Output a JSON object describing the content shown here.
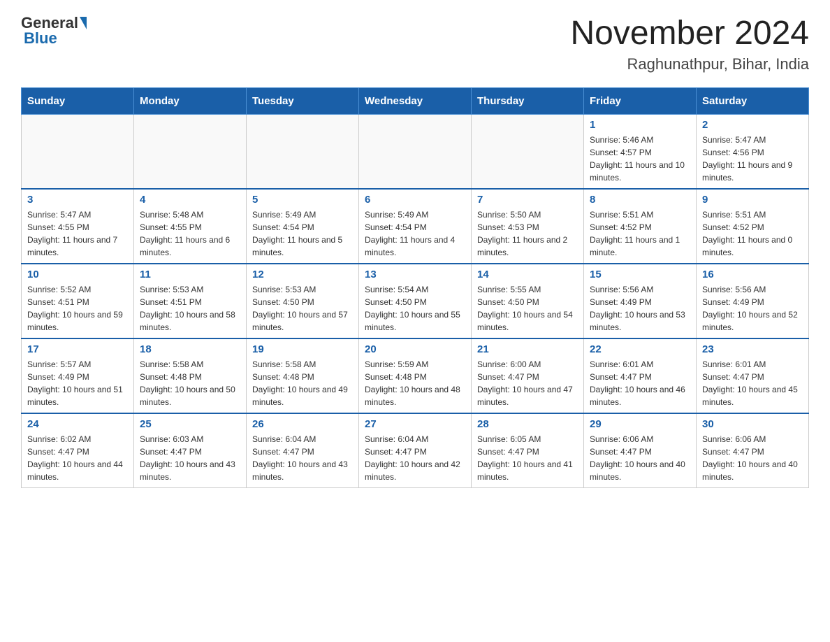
{
  "logo": {
    "text_general": "General",
    "text_blue": "Blue"
  },
  "header": {
    "title": "November 2024",
    "subtitle": "Raghunathpur, Bihar, India"
  },
  "weekdays": [
    "Sunday",
    "Monday",
    "Tuesday",
    "Wednesday",
    "Thursday",
    "Friday",
    "Saturday"
  ],
  "weeks": [
    [
      {
        "day": "",
        "sunrise": "",
        "sunset": "",
        "daylight": ""
      },
      {
        "day": "",
        "sunrise": "",
        "sunset": "",
        "daylight": ""
      },
      {
        "day": "",
        "sunrise": "",
        "sunset": "",
        "daylight": ""
      },
      {
        "day": "",
        "sunrise": "",
        "sunset": "",
        "daylight": ""
      },
      {
        "day": "",
        "sunrise": "",
        "sunset": "",
        "daylight": ""
      },
      {
        "day": "1",
        "sunrise": "Sunrise: 5:46 AM",
        "sunset": "Sunset: 4:57 PM",
        "daylight": "Daylight: 11 hours and 10 minutes."
      },
      {
        "day": "2",
        "sunrise": "Sunrise: 5:47 AM",
        "sunset": "Sunset: 4:56 PM",
        "daylight": "Daylight: 11 hours and 9 minutes."
      }
    ],
    [
      {
        "day": "3",
        "sunrise": "Sunrise: 5:47 AM",
        "sunset": "Sunset: 4:55 PM",
        "daylight": "Daylight: 11 hours and 7 minutes."
      },
      {
        "day": "4",
        "sunrise": "Sunrise: 5:48 AM",
        "sunset": "Sunset: 4:55 PM",
        "daylight": "Daylight: 11 hours and 6 minutes."
      },
      {
        "day": "5",
        "sunrise": "Sunrise: 5:49 AM",
        "sunset": "Sunset: 4:54 PM",
        "daylight": "Daylight: 11 hours and 5 minutes."
      },
      {
        "day": "6",
        "sunrise": "Sunrise: 5:49 AM",
        "sunset": "Sunset: 4:54 PM",
        "daylight": "Daylight: 11 hours and 4 minutes."
      },
      {
        "day": "7",
        "sunrise": "Sunrise: 5:50 AM",
        "sunset": "Sunset: 4:53 PM",
        "daylight": "Daylight: 11 hours and 2 minutes."
      },
      {
        "day": "8",
        "sunrise": "Sunrise: 5:51 AM",
        "sunset": "Sunset: 4:52 PM",
        "daylight": "Daylight: 11 hours and 1 minute."
      },
      {
        "day": "9",
        "sunrise": "Sunrise: 5:51 AM",
        "sunset": "Sunset: 4:52 PM",
        "daylight": "Daylight: 11 hours and 0 minutes."
      }
    ],
    [
      {
        "day": "10",
        "sunrise": "Sunrise: 5:52 AM",
        "sunset": "Sunset: 4:51 PM",
        "daylight": "Daylight: 10 hours and 59 minutes."
      },
      {
        "day": "11",
        "sunrise": "Sunrise: 5:53 AM",
        "sunset": "Sunset: 4:51 PM",
        "daylight": "Daylight: 10 hours and 58 minutes."
      },
      {
        "day": "12",
        "sunrise": "Sunrise: 5:53 AM",
        "sunset": "Sunset: 4:50 PM",
        "daylight": "Daylight: 10 hours and 57 minutes."
      },
      {
        "day": "13",
        "sunrise": "Sunrise: 5:54 AM",
        "sunset": "Sunset: 4:50 PM",
        "daylight": "Daylight: 10 hours and 55 minutes."
      },
      {
        "day": "14",
        "sunrise": "Sunrise: 5:55 AM",
        "sunset": "Sunset: 4:50 PM",
        "daylight": "Daylight: 10 hours and 54 minutes."
      },
      {
        "day": "15",
        "sunrise": "Sunrise: 5:56 AM",
        "sunset": "Sunset: 4:49 PM",
        "daylight": "Daylight: 10 hours and 53 minutes."
      },
      {
        "day": "16",
        "sunrise": "Sunrise: 5:56 AM",
        "sunset": "Sunset: 4:49 PM",
        "daylight": "Daylight: 10 hours and 52 minutes."
      }
    ],
    [
      {
        "day": "17",
        "sunrise": "Sunrise: 5:57 AM",
        "sunset": "Sunset: 4:49 PM",
        "daylight": "Daylight: 10 hours and 51 minutes."
      },
      {
        "day": "18",
        "sunrise": "Sunrise: 5:58 AM",
        "sunset": "Sunset: 4:48 PM",
        "daylight": "Daylight: 10 hours and 50 minutes."
      },
      {
        "day": "19",
        "sunrise": "Sunrise: 5:58 AM",
        "sunset": "Sunset: 4:48 PM",
        "daylight": "Daylight: 10 hours and 49 minutes."
      },
      {
        "day": "20",
        "sunrise": "Sunrise: 5:59 AM",
        "sunset": "Sunset: 4:48 PM",
        "daylight": "Daylight: 10 hours and 48 minutes."
      },
      {
        "day": "21",
        "sunrise": "Sunrise: 6:00 AM",
        "sunset": "Sunset: 4:47 PM",
        "daylight": "Daylight: 10 hours and 47 minutes."
      },
      {
        "day": "22",
        "sunrise": "Sunrise: 6:01 AM",
        "sunset": "Sunset: 4:47 PM",
        "daylight": "Daylight: 10 hours and 46 minutes."
      },
      {
        "day": "23",
        "sunrise": "Sunrise: 6:01 AM",
        "sunset": "Sunset: 4:47 PM",
        "daylight": "Daylight: 10 hours and 45 minutes."
      }
    ],
    [
      {
        "day": "24",
        "sunrise": "Sunrise: 6:02 AM",
        "sunset": "Sunset: 4:47 PM",
        "daylight": "Daylight: 10 hours and 44 minutes."
      },
      {
        "day": "25",
        "sunrise": "Sunrise: 6:03 AM",
        "sunset": "Sunset: 4:47 PM",
        "daylight": "Daylight: 10 hours and 43 minutes."
      },
      {
        "day": "26",
        "sunrise": "Sunrise: 6:04 AM",
        "sunset": "Sunset: 4:47 PM",
        "daylight": "Daylight: 10 hours and 43 minutes."
      },
      {
        "day": "27",
        "sunrise": "Sunrise: 6:04 AM",
        "sunset": "Sunset: 4:47 PM",
        "daylight": "Daylight: 10 hours and 42 minutes."
      },
      {
        "day": "28",
        "sunrise": "Sunrise: 6:05 AM",
        "sunset": "Sunset: 4:47 PM",
        "daylight": "Daylight: 10 hours and 41 minutes."
      },
      {
        "day": "29",
        "sunrise": "Sunrise: 6:06 AM",
        "sunset": "Sunset: 4:47 PM",
        "daylight": "Daylight: 10 hours and 40 minutes."
      },
      {
        "day": "30",
        "sunrise": "Sunrise: 6:06 AM",
        "sunset": "Sunset: 4:47 PM",
        "daylight": "Daylight: 10 hours and 40 minutes."
      }
    ]
  ]
}
